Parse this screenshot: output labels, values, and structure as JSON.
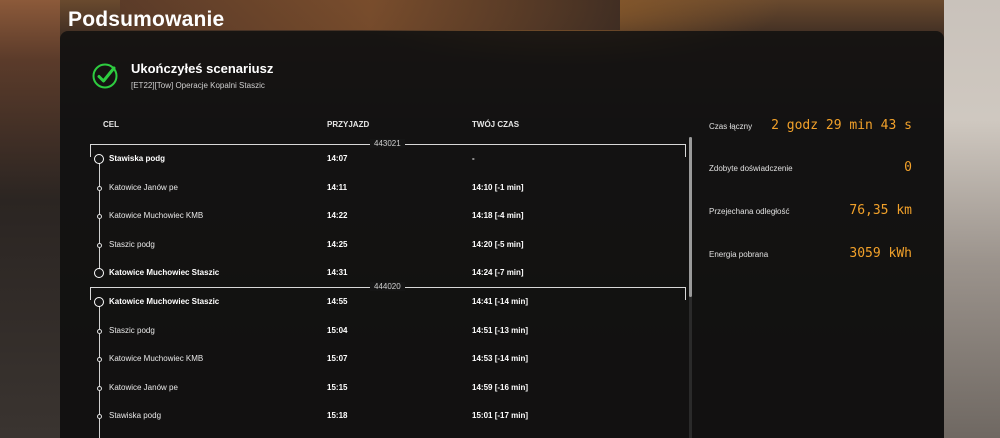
{
  "page": {
    "title": "Podsumowanie"
  },
  "result": {
    "heading": "Ukończyłeś scenariusz",
    "scenario": "[ET22][Tow] Operacje Kopalni Staszic"
  },
  "table": {
    "headers": {
      "stop": "CEL",
      "arrival": "PRZYJAZD",
      "your_time": "TWÓJ CZAS"
    },
    "trains": [
      {
        "number": "443021",
        "stops": [
          {
            "name": "Stawiska podg",
            "arrival": "14:07",
            "time": "-",
            "delay": "",
            "major": true
          },
          {
            "name": "Katowice Janów pe",
            "arrival": "14:11",
            "time": "14:10",
            "delay": "-1 min",
            "major": false
          },
          {
            "name": "Katowice Muchowiec KMB",
            "arrival": "14:22",
            "time": "14:18",
            "delay": "-4 min",
            "major": false
          },
          {
            "name": "Staszic podg",
            "arrival": "14:25",
            "time": "14:20",
            "delay": "-5 min",
            "major": false
          },
          {
            "name": "Katowice Muchowiec Staszic",
            "arrival": "14:31",
            "time": "14:24",
            "delay": "-7 min",
            "major": true
          }
        ]
      },
      {
        "number": "444020",
        "stops": [
          {
            "name": "Katowice Muchowiec Staszic",
            "arrival": "14:55",
            "time": "14:41",
            "delay": "-14 min",
            "major": true
          },
          {
            "name": "Staszic podg",
            "arrival": "15:04",
            "time": "14:51",
            "delay": "-13 min",
            "major": false
          },
          {
            "name": "Katowice Muchowiec KMB",
            "arrival": "15:07",
            "time": "14:53",
            "delay": "-14 min",
            "major": false
          },
          {
            "name": "Katowice Janów pe",
            "arrival": "15:15",
            "time": "14:59",
            "delay": "-16 min",
            "major": false
          },
          {
            "name": "Stawiska podg",
            "arrival": "15:18",
            "time": "15:01",
            "delay": "-17 min",
            "major": false
          }
        ]
      }
    ]
  },
  "stats": [
    {
      "label": "Czas łączny",
      "value": "2 godz 29 min 43 s"
    },
    {
      "label": "Zdobyte doświadczenie",
      "value": "0"
    },
    {
      "label": "Przejechana odległość",
      "value": "76,35 km"
    },
    {
      "label": "Energia pobrana",
      "value": "3059 kWh"
    }
  ],
  "colors": {
    "accent": "#f2a12a",
    "delay_early": "#5be36a",
    "check": "#2ecc40"
  }
}
